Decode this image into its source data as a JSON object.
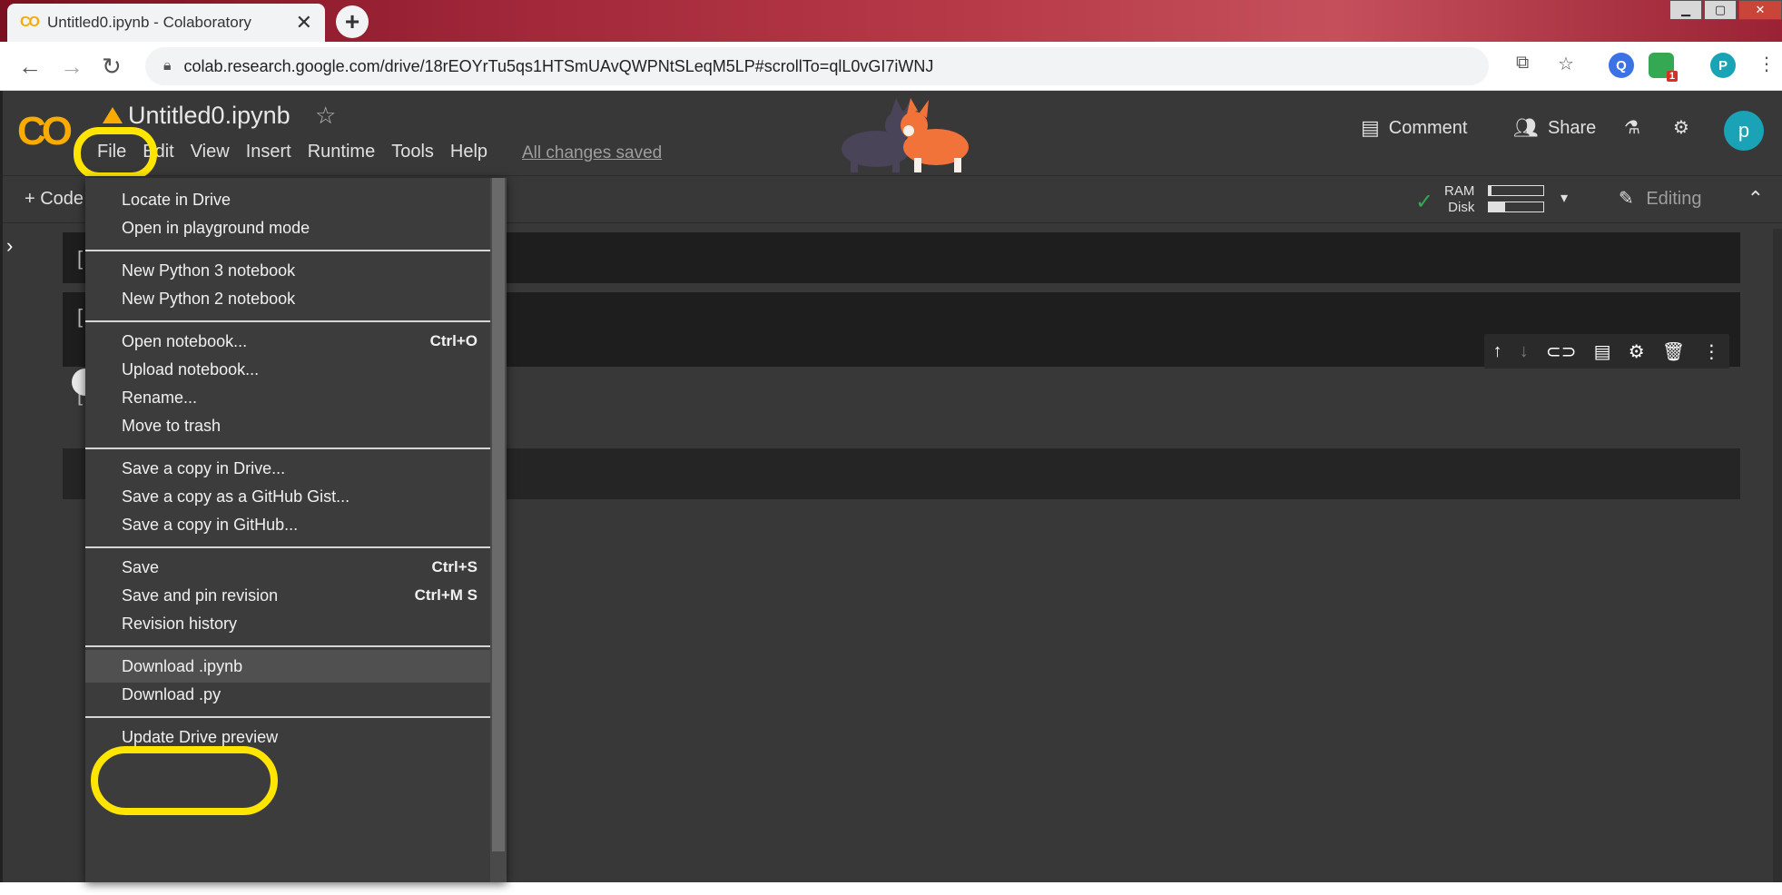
{
  "browser": {
    "tab_title": "Untitled0.ipynb - Colaboratory",
    "tab_icon": "CO",
    "new_tab": "+",
    "url": "colab.research.google.com/drive/18rEOYrTu5qs1HTSmUAvQWPNtSLeqM5LP#scrollTo=qlL0vGI7iWNJ",
    "profile_initial": "P",
    "extension_badge": "1"
  },
  "colab": {
    "logo": "CO",
    "notebook_title": "Untitled0.ipynb",
    "menu": [
      "File",
      "Edit",
      "View",
      "Insert",
      "Runtime",
      "Tools",
      "Help"
    ],
    "save_status": "All changes saved",
    "actions": {
      "comment": "Comment",
      "share": "Share"
    },
    "avatar_initial": "p",
    "add_code": "+ Code",
    "resources": {
      "ram_label": "RAM",
      "disk_label": "Disk",
      "ram_fraction": 0.05,
      "disk_fraction": 0.3
    },
    "mode": "Editing"
  },
  "file_menu": {
    "items": [
      {
        "label": "Locate in Drive",
        "shortcut": ""
      },
      {
        "label": "Open in playground mode",
        "shortcut": ""
      },
      {
        "label": "New Python 3 notebook",
        "shortcut": ""
      },
      {
        "label": "New Python 2 notebook",
        "shortcut": ""
      },
      {
        "label": "Open notebook...",
        "shortcut": "Ctrl+O"
      },
      {
        "label": "Upload notebook...",
        "shortcut": ""
      },
      {
        "label": "Rename...",
        "shortcut": ""
      },
      {
        "label": "Move to trash",
        "shortcut": ""
      },
      {
        "label": "Save a copy in Drive...",
        "shortcut": ""
      },
      {
        "label": "Save a copy as a GitHub Gist...",
        "shortcut": ""
      },
      {
        "label": "Save a copy in GitHub...",
        "shortcut": ""
      },
      {
        "label": "Save",
        "shortcut": "Ctrl+S"
      },
      {
        "label": "Save and pin revision",
        "shortcut": "Ctrl+M S"
      },
      {
        "label": "Revision history",
        "shortcut": ""
      },
      {
        "label": "Download .ipynb",
        "shortcut": ""
      },
      {
        "label": "Download .py",
        "shortcut": ""
      },
      {
        "label": "Update Drive preview",
        "shortcut": ""
      }
    ],
    "highlighted_item": "Download .ipynb"
  },
  "colors": {
    "app_bg": "#383838",
    "menu_bg": "#3c3c3c",
    "colab_orange": "#f9ab00",
    "annotation_yellow": "#ffe500",
    "avatar_teal": "#1aa3b7"
  }
}
